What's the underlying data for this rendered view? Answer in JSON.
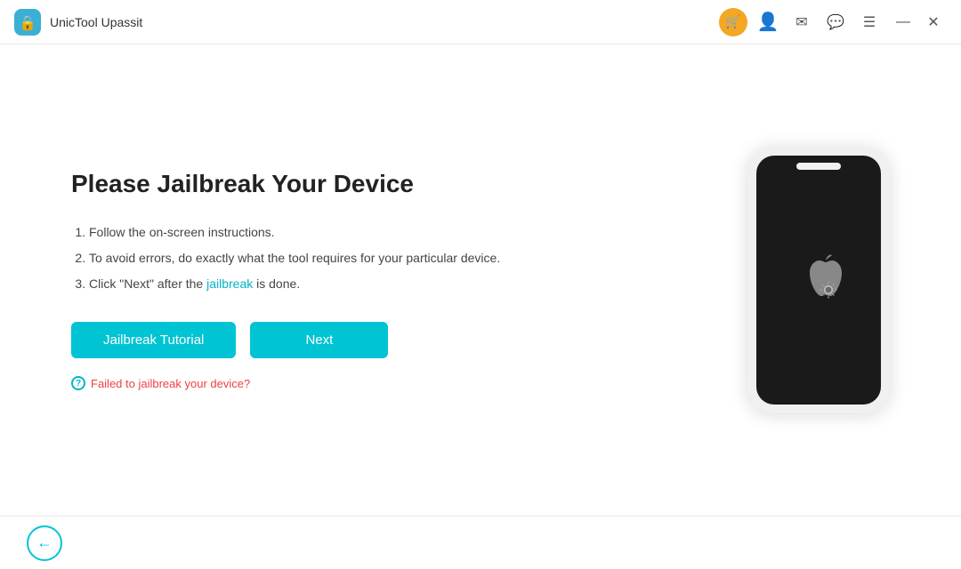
{
  "app": {
    "name": "UnicTool Upassit"
  },
  "titlebar": {
    "cart_icon": "🛒",
    "user_icon": "👤",
    "mail_icon": "✉",
    "chat_icon": "💬",
    "menu_icon": "☰",
    "minimize_icon": "—",
    "close_icon": "✕"
  },
  "main": {
    "page_title": "Please Jailbreak Your Device",
    "instructions": [
      "Follow the on-screen instructions.",
      "To avoid errors, do exactly what the tool requires for your particular device.",
      "Click \"Next\" after the jailbreak is done."
    ],
    "highlight_words": [
      "jailbreak"
    ],
    "jailbreak_tutorial_btn": "Jailbreak Tutorial",
    "next_btn": "Next",
    "failed_link": "Failed to jailbreak your device?"
  },
  "footer": {
    "back_arrow": "←"
  }
}
